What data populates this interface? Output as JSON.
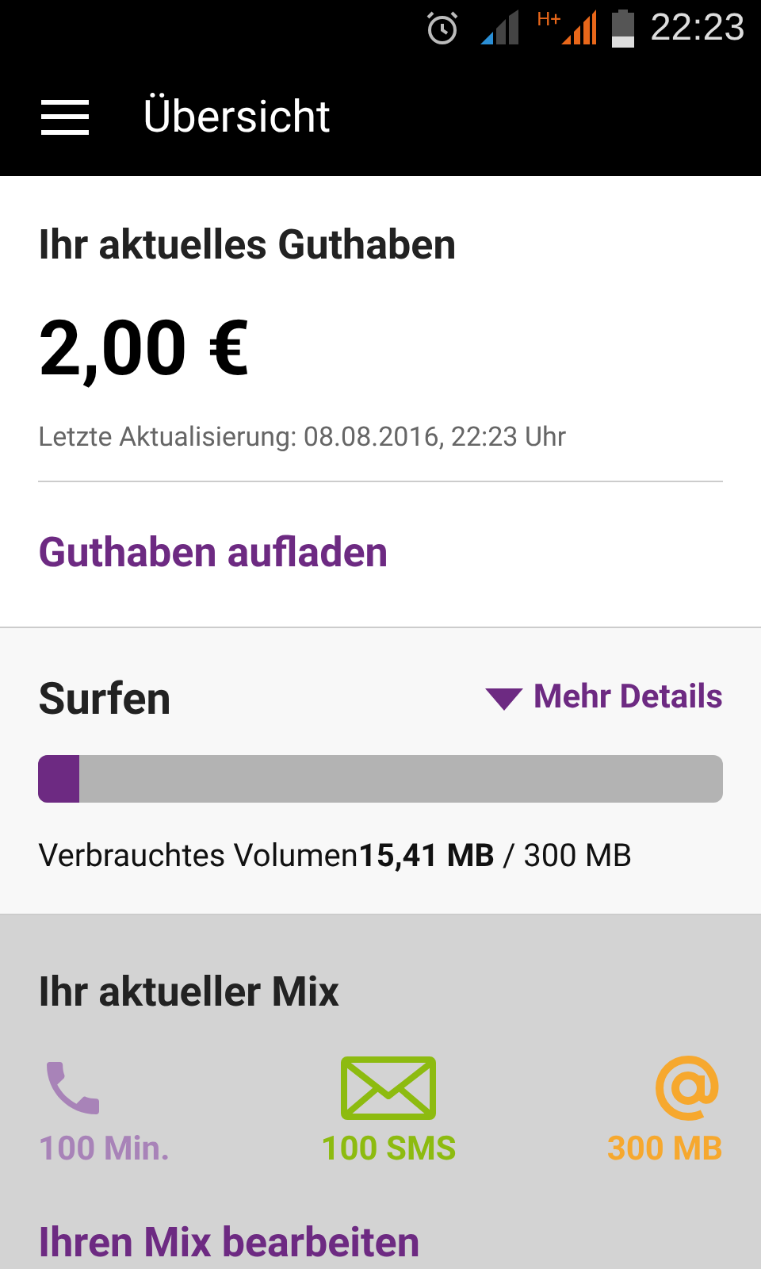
{
  "status_bar": {
    "network_type": "H+",
    "time": "22:23"
  },
  "app_bar": {
    "title": "Übersicht"
  },
  "balance": {
    "title": "Ihr aktuelles Guthaben",
    "amount": "2,00 €",
    "updated": "Letzte Aktualisierung: 08.08.2016, 22:23 Uhr",
    "action": "Guthaben aufladen"
  },
  "surfen": {
    "title": "Surfen",
    "details_link": "Mehr Details",
    "level": 0.06,
    "usage": "Verbrauchtes Volumen**15,41 MB** / 300 MB"
  },
  "mix": {
    "title": "Ihr aktueller Mix",
    "items": [
      {
        "kind": "phone",
        "label": "100 Min.",
        "color": "#a883b8"
      },
      {
        "kind": "sms",
        "label": "100 SMS",
        "color": "#8dbb10"
      },
      {
        "kind": "data",
        "label": "300 MB",
        "color": "#f6a82e"
      }
    ],
    "action": "Ihren Mix bearbeiten"
  }
}
